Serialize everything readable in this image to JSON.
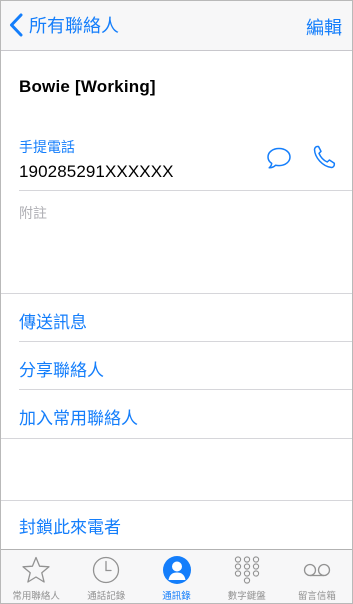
{
  "nav": {
    "back_label": "所有聯絡人",
    "edit_label": "編輯"
  },
  "contact": {
    "name": "Bowie [Working]",
    "phone_label": "手提電話",
    "phone_number": "190285291XXXXXX",
    "notes_label": "附註"
  },
  "actions": {
    "send_message": "傳送訊息",
    "share_contact": "分享聯絡人",
    "add_favorite": "加入常用聯絡人",
    "block_caller": "封鎖此來電者"
  },
  "tabs": [
    {
      "label": "常用聯絡人",
      "icon": "star-icon",
      "active": false
    },
    {
      "label": "通話記錄",
      "icon": "clock-icon",
      "active": false
    },
    {
      "label": "通訊錄",
      "icon": "person-icon",
      "active": true
    },
    {
      "label": "數字鍵盤",
      "icon": "keypad-icon",
      "active": false
    },
    {
      "label": "留言信箱",
      "icon": "voicemail-icon",
      "active": false
    }
  ],
  "colors": {
    "accent": "#147efb",
    "inactive": "#929292",
    "bar_background": "#f7f7f8"
  }
}
